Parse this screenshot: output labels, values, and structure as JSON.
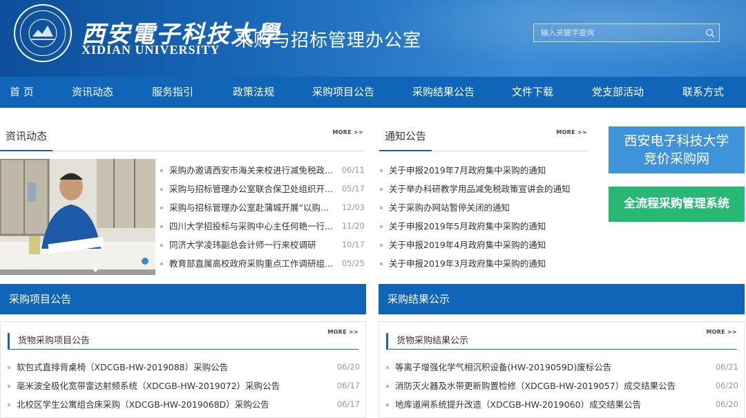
{
  "header": {
    "university_cn": "西安電子科技大學",
    "university_en": "XIDIAN UNIVERSITY",
    "department": "采购与招标管理办公室",
    "search_placeholder": "输入关键字查询",
    "logo_text": "XIDIAN UNIVERSITY"
  },
  "nav": [
    "首 页",
    "资讯动态",
    "服务指引",
    "政策法规",
    "采购项目公告",
    "采购结果公告",
    "文件下载",
    "党支部活动",
    "联系方式"
  ],
  "news": {
    "title": "资讯动态",
    "more": "MORE >>",
    "items": [
      {
        "text": "采购办邀请西安市海关来校进行减免税政...",
        "date": "06/11"
      },
      {
        "text": "采购与招标管理办公室联合保卫处组织开...",
        "date": "05/17"
      },
      {
        "text": "采购与招标管理办公室赴蒲城开展“以购...",
        "date": "12/03"
      },
      {
        "text": "四川大学招投标与采购中心主任何艳一行...",
        "date": "11/20"
      },
      {
        "text": "同济大学凌玮副总会计师一行来校调研",
        "date": "10/17"
      },
      {
        "text": "教育部直属高校政府采购重点工作调研组...",
        "date": "05/25"
      }
    ]
  },
  "notices": {
    "title": "通知公告",
    "more": "MORE >>",
    "items": [
      "关于申报2019年7月政府集中采购的通知",
      "关于举办科研教学用品减免税政策宣讲会的通知",
      "关于采购办网站暂停关闭的通知",
      "关于申报2019年5月政府集中采购的通知",
      "关于申报2019年4月政府集中采购的通知",
      "关于申报2019年3月政府集中采购的通知"
    ]
  },
  "banners": {
    "bidding_line1": "西安电子科技大学",
    "bidding_line2": "竞价采购网",
    "system": "全流程采购管理系统"
  },
  "procurement": {
    "bar": "采购项目公告",
    "sub": "货物采购项目公告",
    "more": "MORE >>",
    "items": [
      {
        "text": "软包式直排背桌椅（XDCGB-HW-2019088）采购公告",
        "date": "06/20"
      },
      {
        "text": "毫米波全极化宽带雷达射频系统（XDCGB-HW-2019072）采购公告",
        "date": "06/17"
      },
      {
        "text": "北校区学生公寓组合床采购（XDCGB-HW-2019068D）采购公告",
        "date": "06/17"
      }
    ]
  },
  "results": {
    "bar": "采购结果公示",
    "sub": "货物采购结果公示",
    "more": "MORE >>",
    "items": [
      {
        "text": "等离子增强化学气相沉积设备(HW-2019059D)废标公告",
        "date": "06/21"
      },
      {
        "text": "消防灭火器及水带更新购置检修（XDCGB-HW-2019057）成交结果公告",
        "date": "06/20"
      },
      {
        "text": "地库道闸系统提升改造（XDCGB-HW-2019060）成交结果公告",
        "date": "06/20"
      }
    ]
  },
  "colors": {
    "header_blue": "#1165b8",
    "banner_blue": "#3f94d9",
    "banner_green": "#27b876"
  }
}
